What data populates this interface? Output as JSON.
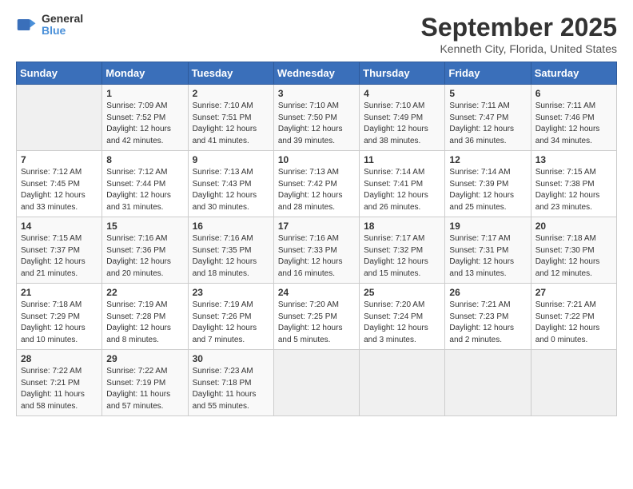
{
  "header": {
    "logo_line1": "General",
    "logo_line2": "Blue",
    "month": "September 2025",
    "location": "Kenneth City, Florida, United States"
  },
  "weekdays": [
    "Sunday",
    "Monday",
    "Tuesday",
    "Wednesday",
    "Thursday",
    "Friday",
    "Saturday"
  ],
  "weeks": [
    [
      {
        "day": "",
        "info": ""
      },
      {
        "day": "1",
        "info": "Sunrise: 7:09 AM\nSunset: 7:52 PM\nDaylight: 12 hours\nand 42 minutes."
      },
      {
        "day": "2",
        "info": "Sunrise: 7:10 AM\nSunset: 7:51 PM\nDaylight: 12 hours\nand 41 minutes."
      },
      {
        "day": "3",
        "info": "Sunrise: 7:10 AM\nSunset: 7:50 PM\nDaylight: 12 hours\nand 39 minutes."
      },
      {
        "day": "4",
        "info": "Sunrise: 7:10 AM\nSunset: 7:49 PM\nDaylight: 12 hours\nand 38 minutes."
      },
      {
        "day": "5",
        "info": "Sunrise: 7:11 AM\nSunset: 7:47 PM\nDaylight: 12 hours\nand 36 minutes."
      },
      {
        "day": "6",
        "info": "Sunrise: 7:11 AM\nSunset: 7:46 PM\nDaylight: 12 hours\nand 34 minutes."
      }
    ],
    [
      {
        "day": "7",
        "info": "Sunrise: 7:12 AM\nSunset: 7:45 PM\nDaylight: 12 hours\nand 33 minutes."
      },
      {
        "day": "8",
        "info": "Sunrise: 7:12 AM\nSunset: 7:44 PM\nDaylight: 12 hours\nand 31 minutes."
      },
      {
        "day": "9",
        "info": "Sunrise: 7:13 AM\nSunset: 7:43 PM\nDaylight: 12 hours\nand 30 minutes."
      },
      {
        "day": "10",
        "info": "Sunrise: 7:13 AM\nSunset: 7:42 PM\nDaylight: 12 hours\nand 28 minutes."
      },
      {
        "day": "11",
        "info": "Sunrise: 7:14 AM\nSunset: 7:41 PM\nDaylight: 12 hours\nand 26 minutes."
      },
      {
        "day": "12",
        "info": "Sunrise: 7:14 AM\nSunset: 7:39 PM\nDaylight: 12 hours\nand 25 minutes."
      },
      {
        "day": "13",
        "info": "Sunrise: 7:15 AM\nSunset: 7:38 PM\nDaylight: 12 hours\nand 23 minutes."
      }
    ],
    [
      {
        "day": "14",
        "info": "Sunrise: 7:15 AM\nSunset: 7:37 PM\nDaylight: 12 hours\nand 21 minutes."
      },
      {
        "day": "15",
        "info": "Sunrise: 7:16 AM\nSunset: 7:36 PM\nDaylight: 12 hours\nand 20 minutes."
      },
      {
        "day": "16",
        "info": "Sunrise: 7:16 AM\nSunset: 7:35 PM\nDaylight: 12 hours\nand 18 minutes."
      },
      {
        "day": "17",
        "info": "Sunrise: 7:16 AM\nSunset: 7:33 PM\nDaylight: 12 hours\nand 16 minutes."
      },
      {
        "day": "18",
        "info": "Sunrise: 7:17 AM\nSunset: 7:32 PM\nDaylight: 12 hours\nand 15 minutes."
      },
      {
        "day": "19",
        "info": "Sunrise: 7:17 AM\nSunset: 7:31 PM\nDaylight: 12 hours\nand 13 minutes."
      },
      {
        "day": "20",
        "info": "Sunrise: 7:18 AM\nSunset: 7:30 PM\nDaylight: 12 hours\nand 12 minutes."
      }
    ],
    [
      {
        "day": "21",
        "info": "Sunrise: 7:18 AM\nSunset: 7:29 PM\nDaylight: 12 hours\nand 10 minutes."
      },
      {
        "day": "22",
        "info": "Sunrise: 7:19 AM\nSunset: 7:28 PM\nDaylight: 12 hours\nand 8 minutes."
      },
      {
        "day": "23",
        "info": "Sunrise: 7:19 AM\nSunset: 7:26 PM\nDaylight: 12 hours\nand 7 minutes."
      },
      {
        "day": "24",
        "info": "Sunrise: 7:20 AM\nSunset: 7:25 PM\nDaylight: 12 hours\nand 5 minutes."
      },
      {
        "day": "25",
        "info": "Sunrise: 7:20 AM\nSunset: 7:24 PM\nDaylight: 12 hours\nand 3 minutes."
      },
      {
        "day": "26",
        "info": "Sunrise: 7:21 AM\nSunset: 7:23 PM\nDaylight: 12 hours\nand 2 minutes."
      },
      {
        "day": "27",
        "info": "Sunrise: 7:21 AM\nSunset: 7:22 PM\nDaylight: 12 hours\nand 0 minutes."
      }
    ],
    [
      {
        "day": "28",
        "info": "Sunrise: 7:22 AM\nSunset: 7:21 PM\nDaylight: 11 hours\nand 58 minutes."
      },
      {
        "day": "29",
        "info": "Sunrise: 7:22 AM\nSunset: 7:19 PM\nDaylight: 11 hours\nand 57 minutes."
      },
      {
        "day": "30",
        "info": "Sunrise: 7:23 AM\nSunset: 7:18 PM\nDaylight: 11 hours\nand 55 minutes."
      },
      {
        "day": "",
        "info": ""
      },
      {
        "day": "",
        "info": ""
      },
      {
        "day": "",
        "info": ""
      },
      {
        "day": "",
        "info": ""
      }
    ]
  ]
}
